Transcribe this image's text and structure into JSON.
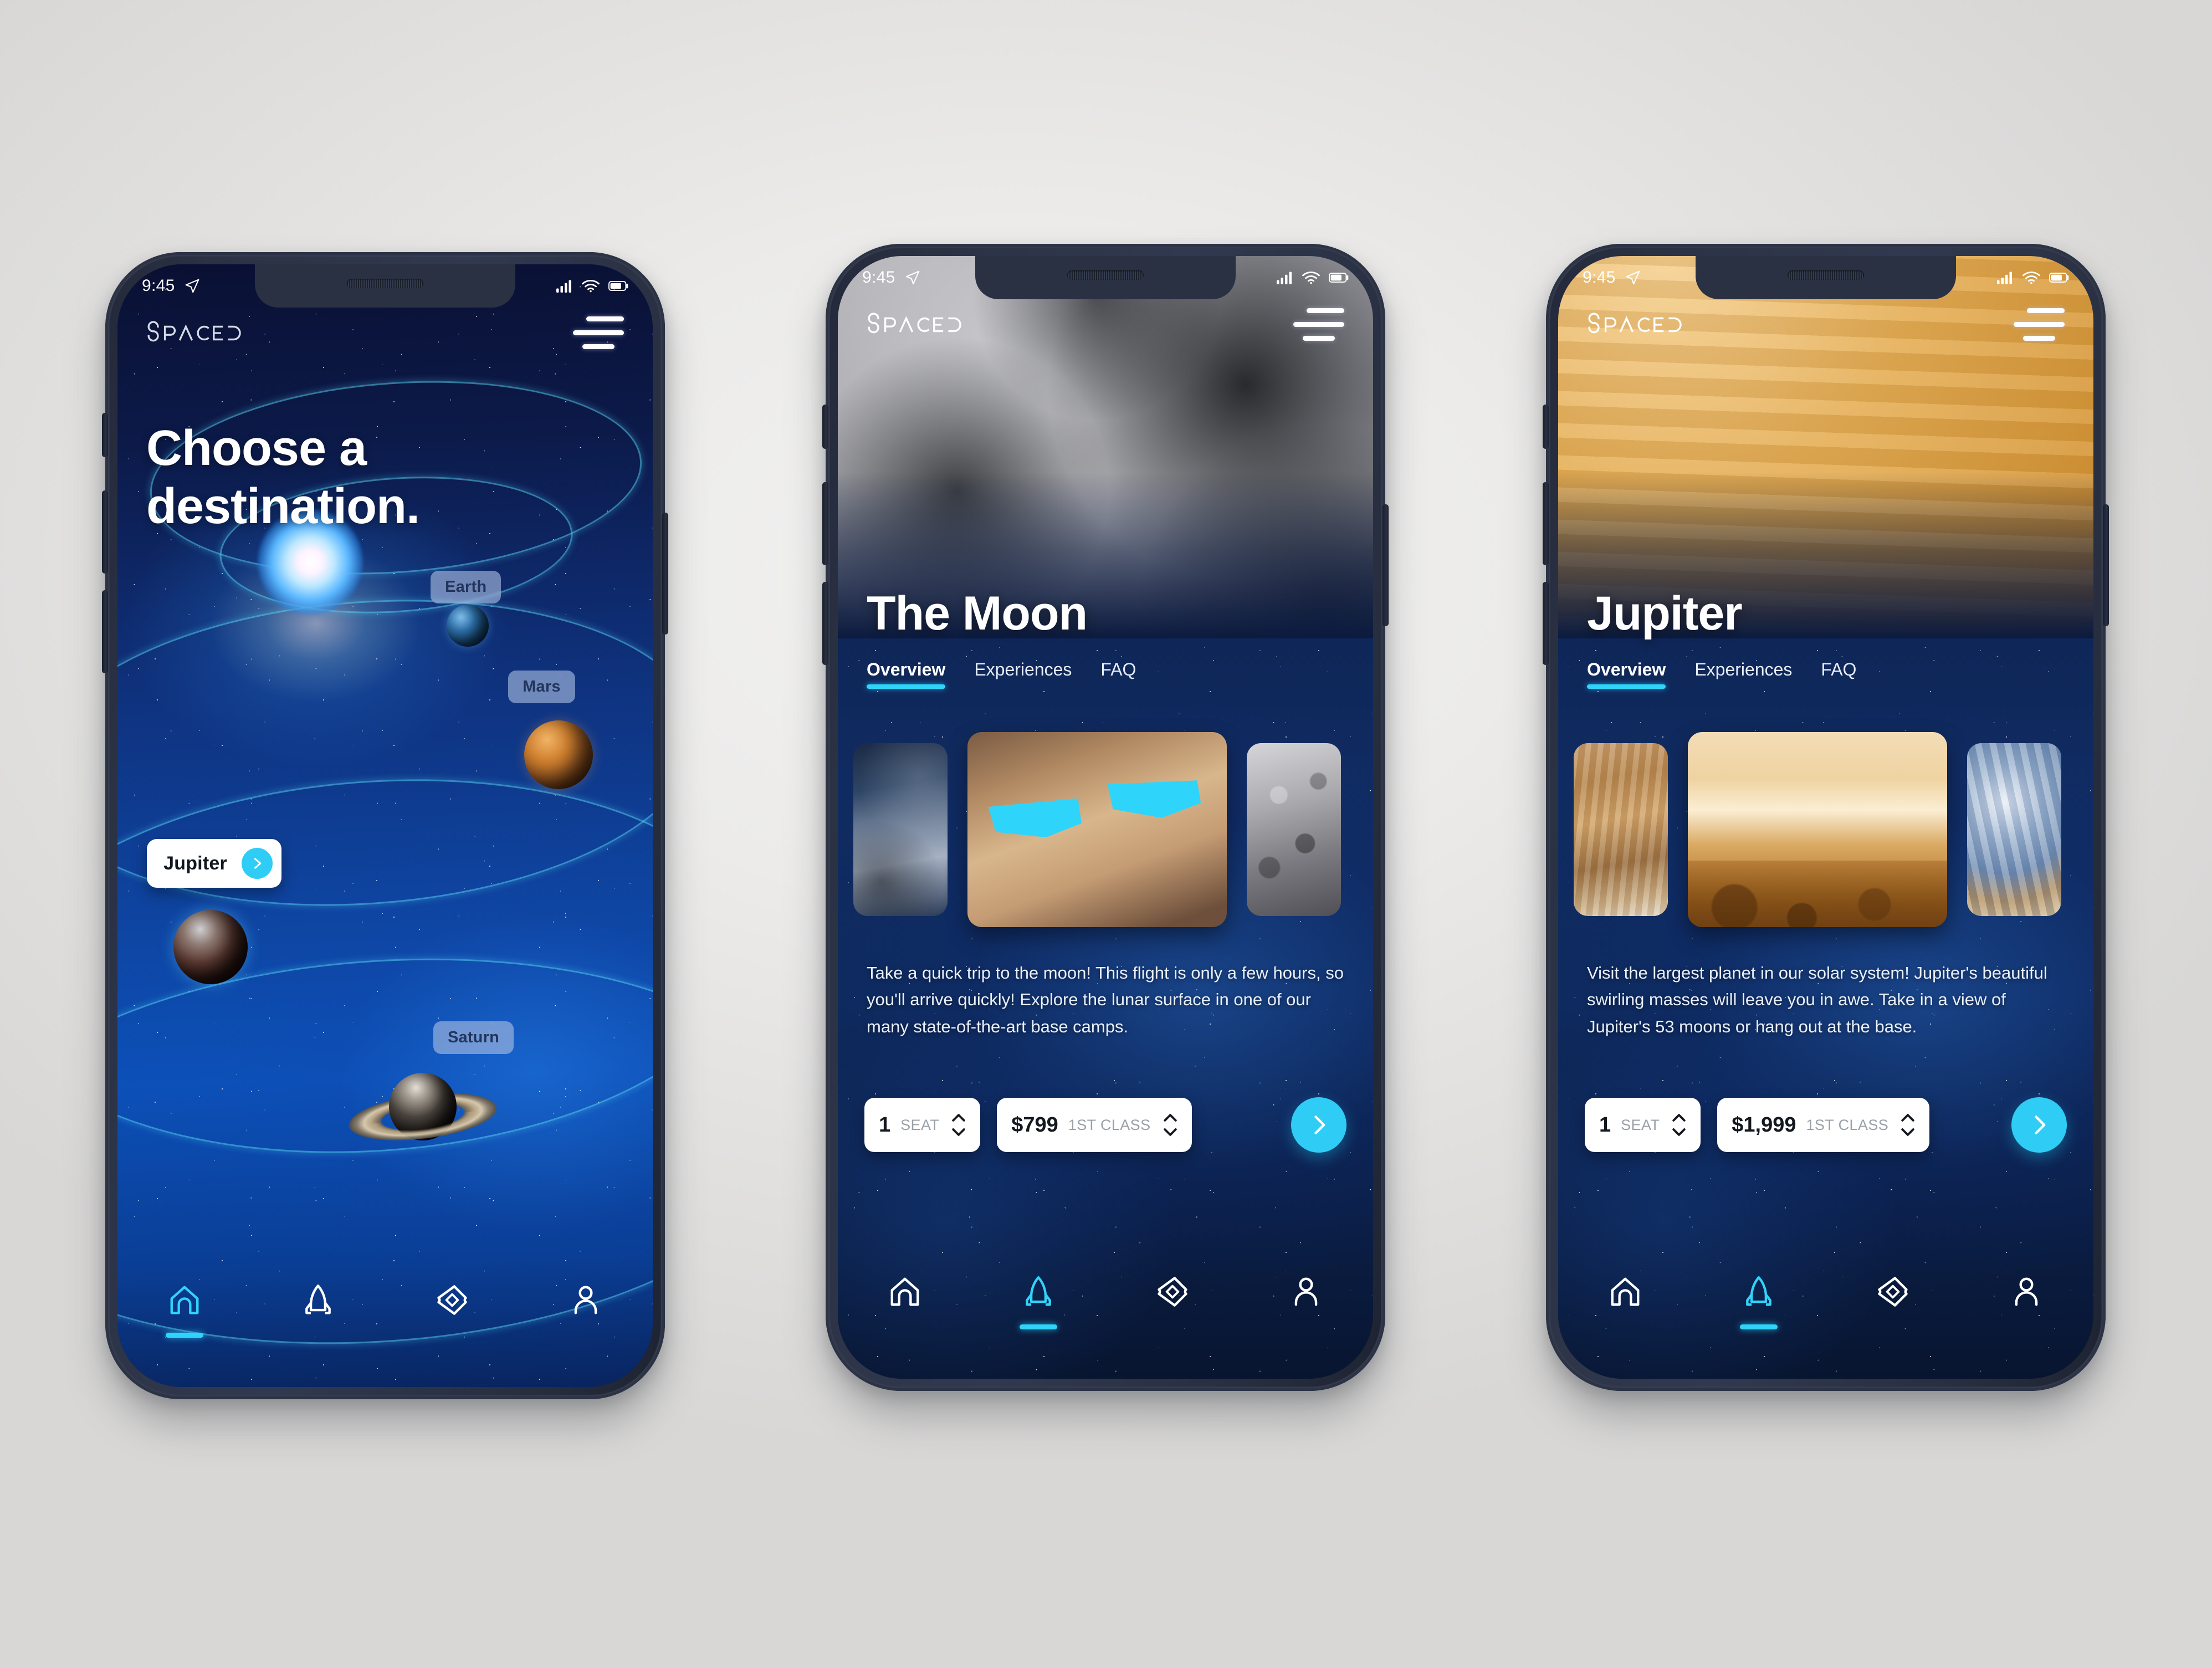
{
  "brand": {
    "name": "SPACED",
    "logo_icon": "spaced-wordmark"
  },
  "status_bar": {
    "time": "9:45",
    "location_icon": "location-arrow-icon",
    "signal_icon": "cellular-signal-icon",
    "wifi_icon": "wifi-icon",
    "battery_icon": "battery-icon"
  },
  "colors": {
    "accent_cyan": "#2fd4fb",
    "cta_cyan": "#2fcdf5",
    "deep_navy": "#0a1033",
    "space_blue": "#0e45a2",
    "jupiter_gold": "#e5ae55",
    "moon_gray": "#9d9da3",
    "page_background": "#eceae9",
    "phone_frame": "#2b3244"
  },
  "nav": {
    "items": [
      {
        "icon": "home-icon",
        "name": "home",
        "active_on": [
          1
        ]
      },
      {
        "icon": "rocket-icon",
        "name": "flights",
        "active_on": [
          2,
          3
        ]
      },
      {
        "icon": "ticket-icon",
        "name": "tickets",
        "active_on": []
      },
      {
        "icon": "person-icon",
        "name": "profile",
        "active_on": []
      }
    ]
  },
  "menu_icon": "hamburger-menu-icon",
  "screens": [
    {
      "id": "choose-destination",
      "headline_line1": "Choose a",
      "headline_line2": "destination.",
      "planets": [
        {
          "label": "Earth",
          "selected": false
        },
        {
          "label": "Mars",
          "selected": false
        },
        {
          "label": "Jupiter",
          "selected": true,
          "arrow_icon": "chevron-right-icon"
        },
        {
          "label": "Saturn",
          "selected": false
        }
      ],
      "active_nav": "home"
    },
    {
      "id": "the-moon",
      "title": "The Moon",
      "tabs": [
        {
          "label": "Overview",
          "active": true
        },
        {
          "label": "Experiences",
          "active": false
        },
        {
          "label": "FAQ",
          "active": false
        }
      ],
      "gallery": [
        {
          "alt": "lunar-surface-thumbnail"
        },
        {
          "alt": "people-wearing-cyan-glasses-photo"
        },
        {
          "alt": "moon-craters-thumbnail"
        }
      ],
      "description": "Take a quick trip to the moon! This flight is only a few hours, so you'll arrive quickly! Explore the lunar surface in one of our many state-of-the-art base camps.",
      "seats": {
        "value": "1",
        "label": "SEAT",
        "stepper_icon": "up-down-chevrons-icon"
      },
      "price": {
        "value": "$799",
        "label": "1ST CLASS",
        "stepper_icon": "up-down-chevrons-icon"
      },
      "cta_icon": "chevron-right-icon",
      "active_nav": "flights"
    },
    {
      "id": "jupiter",
      "title": "Jupiter",
      "tabs": [
        {
          "label": "Overview",
          "active": true
        },
        {
          "label": "Experiences",
          "active": false
        },
        {
          "label": "FAQ",
          "active": false
        }
      ],
      "gallery": [
        {
          "alt": "jupiter-clouds-thumbnail"
        },
        {
          "alt": "golden-landscape-photo"
        },
        {
          "alt": "jupiter-blue-storm-thumbnail"
        }
      ],
      "description": "Visit the largest planet in our solar system! Jupiter's beautiful swirling masses will leave you in awe. Take in a view of Jupiter's 53 moons or hang out at the base.",
      "seats": {
        "value": "1",
        "label": "SEAT",
        "stepper_icon": "up-down-chevrons-icon"
      },
      "price": {
        "value": "$1,999",
        "label": "1ST CLASS",
        "stepper_icon": "up-down-chevrons-icon"
      },
      "cta_icon": "chevron-right-icon",
      "active_nav": "flights"
    }
  ]
}
